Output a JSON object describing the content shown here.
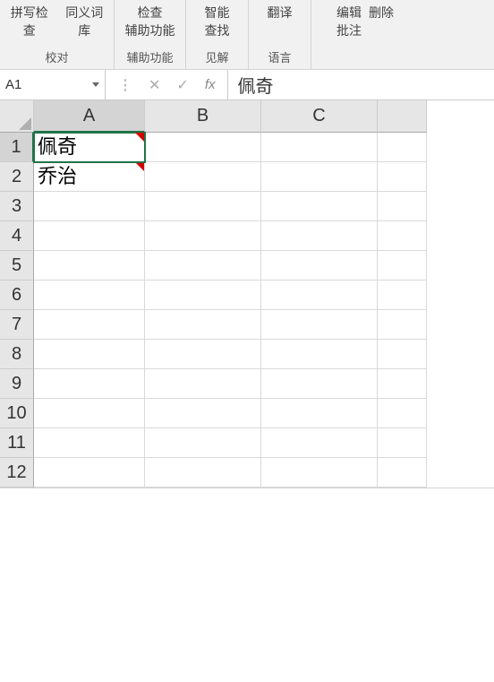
{
  "ribbon": {
    "groups": [
      {
        "buttons": [
          {
            "line1": "拼写检查",
            "line2": ""
          },
          {
            "line1": "同义词库",
            "line2": ""
          }
        ],
        "label": "校对"
      },
      {
        "buttons": [
          {
            "line1": "检查",
            "line2": "辅助功能"
          }
        ],
        "label": "辅助功能"
      },
      {
        "buttons": [
          {
            "line1": "智能",
            "line2": "查找"
          }
        ],
        "label": "见解"
      },
      {
        "buttons": [
          {
            "line1": "翻译",
            "line2": ""
          }
        ],
        "label": "语言"
      },
      {
        "buttons": [
          {
            "line1": "编辑",
            "line2": "批注"
          },
          {
            "line1": "删除",
            "line2": ""
          }
        ],
        "label": ""
      }
    ]
  },
  "formulaBar": {
    "nameBox": "A1",
    "value": "佩奇"
  },
  "columns": [
    "A",
    "B",
    "C",
    ""
  ],
  "activeColumnIndex": 0,
  "rows": [
    "1",
    "2",
    "3",
    "4",
    "5",
    "6",
    "7",
    "8",
    "9",
    "10",
    "11",
    "12"
  ],
  "activeRowIndex": 0,
  "cells": {
    "A1": {
      "value": "佩奇",
      "hasComment": true,
      "selected": true
    },
    "A2": {
      "value": "乔治",
      "hasComment": true
    }
  }
}
